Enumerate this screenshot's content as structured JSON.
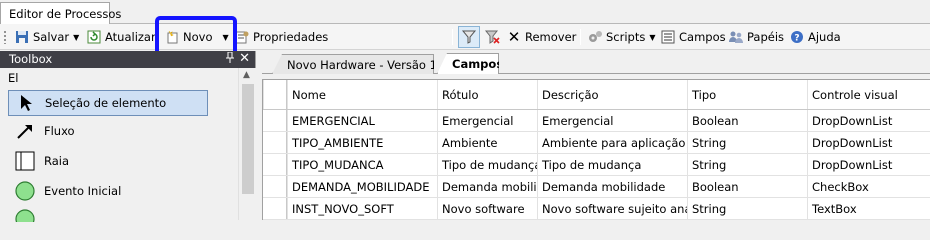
{
  "window": {
    "tab_title": "Editor de Processos"
  },
  "toolbar": {
    "save_label": "Salvar",
    "update_label": "Atualizar",
    "new_label": "Novo",
    "properties_label": "Propriedades",
    "remove_label": "Remover",
    "scripts_label": "Scripts",
    "fields_label": "Campos",
    "roles_label": "Papéis",
    "help_label": "Ajuda"
  },
  "toolbox": {
    "title": "Toolbox",
    "group_label": "El",
    "items": [
      {
        "label": "Seleção de elemento",
        "icon": "pointer-icon",
        "selected": true
      },
      {
        "label": "Fluxo",
        "icon": "arrow-icon"
      },
      {
        "label": "Raia",
        "icon": "lane-icon"
      },
      {
        "label": "Evento Inicial",
        "icon": "start-event-icon"
      }
    ]
  },
  "content": {
    "tabs": [
      {
        "label": "Novo Hardware - Versão 1",
        "active": false
      },
      {
        "label": "Campos",
        "active": true
      }
    ],
    "table": {
      "columns": [
        "Nome",
        "Rótulo",
        "Descrição",
        "Tipo",
        "Controle visual"
      ],
      "rows": [
        [
          "EMERGENCIAL",
          "Emergencial",
          "Emergencial",
          "Boolean",
          "DropDownList"
        ],
        [
          "TIPO_AMBIENTE",
          "Ambiente",
          "Ambiente para aplicação de...",
          "String",
          "DropDownList"
        ],
        [
          "TIPO_MUDANCA",
          "Tipo de mudança",
          "Tipo de mudança",
          "String",
          "DropDownList"
        ],
        [
          "DEMANDA_MOBILIDADE",
          "Demanda mobilid...",
          "Demanda mobilidade",
          "Boolean",
          "CheckBox"
        ],
        [
          "INST_NOVO_SOFT",
          "Novo software",
          "Novo software sujeito anális...",
          "String",
          "TextBox"
        ]
      ]
    }
  },
  "colors": {
    "highlight_box": "#1414ff",
    "selected_tool": "#cfe0f4",
    "toolbox_header": "#3f3f46",
    "start_event": "#8ee08e"
  }
}
